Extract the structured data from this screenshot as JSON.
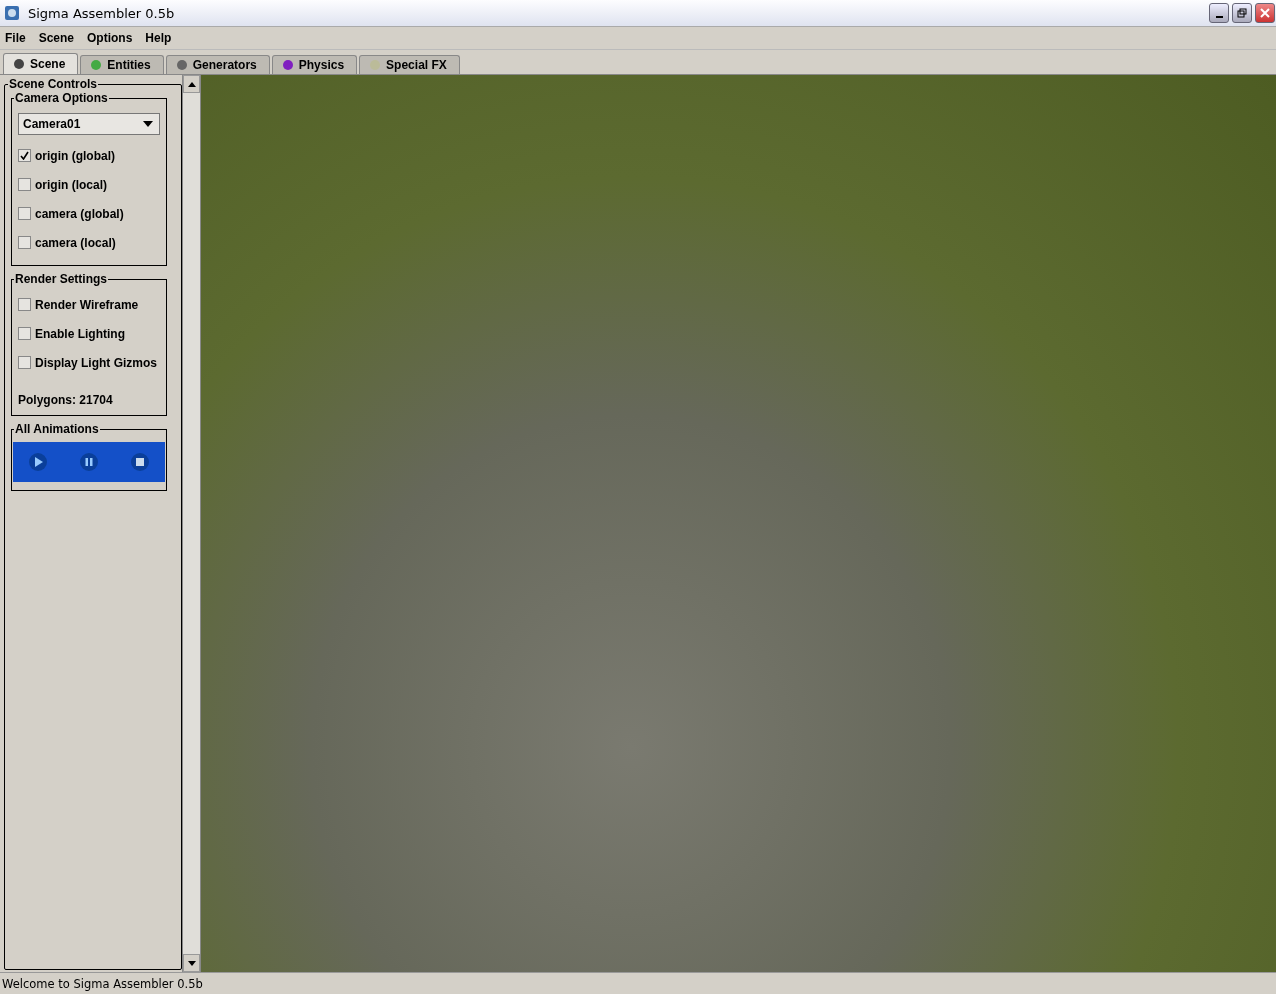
{
  "window": {
    "title": "Sigma Assembler 0.5b"
  },
  "menu": [
    "File",
    "Scene",
    "Options",
    "Help"
  ],
  "tabs": [
    {
      "label": "Scene",
      "selected": true
    },
    {
      "label": "Entities",
      "selected": false
    },
    {
      "label": "Generators",
      "selected": false
    },
    {
      "label": "Physics",
      "selected": false
    },
    {
      "label": "Special FX",
      "selected": false
    }
  ],
  "scene_controls": {
    "title": "Scene Controls",
    "camera_options": {
      "title": "Camera Options",
      "camera": "Camera01",
      "checkboxes": [
        {
          "label": "origin (global)",
          "checked": true
        },
        {
          "label": "origin (local)",
          "checked": false
        },
        {
          "label": "camera (global)",
          "checked": false
        },
        {
          "label": "camera (local)",
          "checked": false
        }
      ]
    },
    "render_settings": {
      "title": "Render Settings",
      "checkboxes": [
        {
          "label": "Render Wireframe",
          "checked": false
        },
        {
          "label": "Enable Lighting",
          "checked": false
        },
        {
          "label": "Display Light Gizmos",
          "checked": false
        }
      ],
      "polygons": "Polygons: 21704"
    },
    "animations": {
      "title": "All Animations",
      "buttons": [
        {
          "kind": "play"
        },
        {
          "kind": "pause"
        },
        {
          "kind": "stop"
        }
      ]
    }
  },
  "status_bar": "Welcome to Sigma Assembler 0.5b"
}
